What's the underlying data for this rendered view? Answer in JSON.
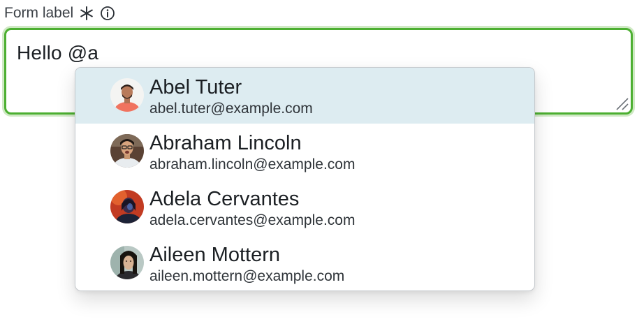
{
  "form": {
    "label": "Form label",
    "required_icon": "asterisk-icon",
    "info_icon": "info-circle-icon",
    "value": "Hello @a",
    "accent_color": "#4caf31"
  },
  "mention_dropdown": {
    "highlight_color": "#ddecf1",
    "options": [
      {
        "name": "Abel Tuter",
        "email": "abel.tuter@example.com",
        "avatar": "avatar-photo"
      },
      {
        "name": "Abraham Lincoln",
        "email": "abraham.lincoln@example.com",
        "avatar": "avatar-photo"
      },
      {
        "name": "Adela Cervantes",
        "email": "adela.cervantes@example.com",
        "avatar": "avatar-photo"
      },
      {
        "name": "Aileen Mottern",
        "email": "aileen.mottern@example.com",
        "avatar": "avatar-photo"
      }
    ]
  }
}
